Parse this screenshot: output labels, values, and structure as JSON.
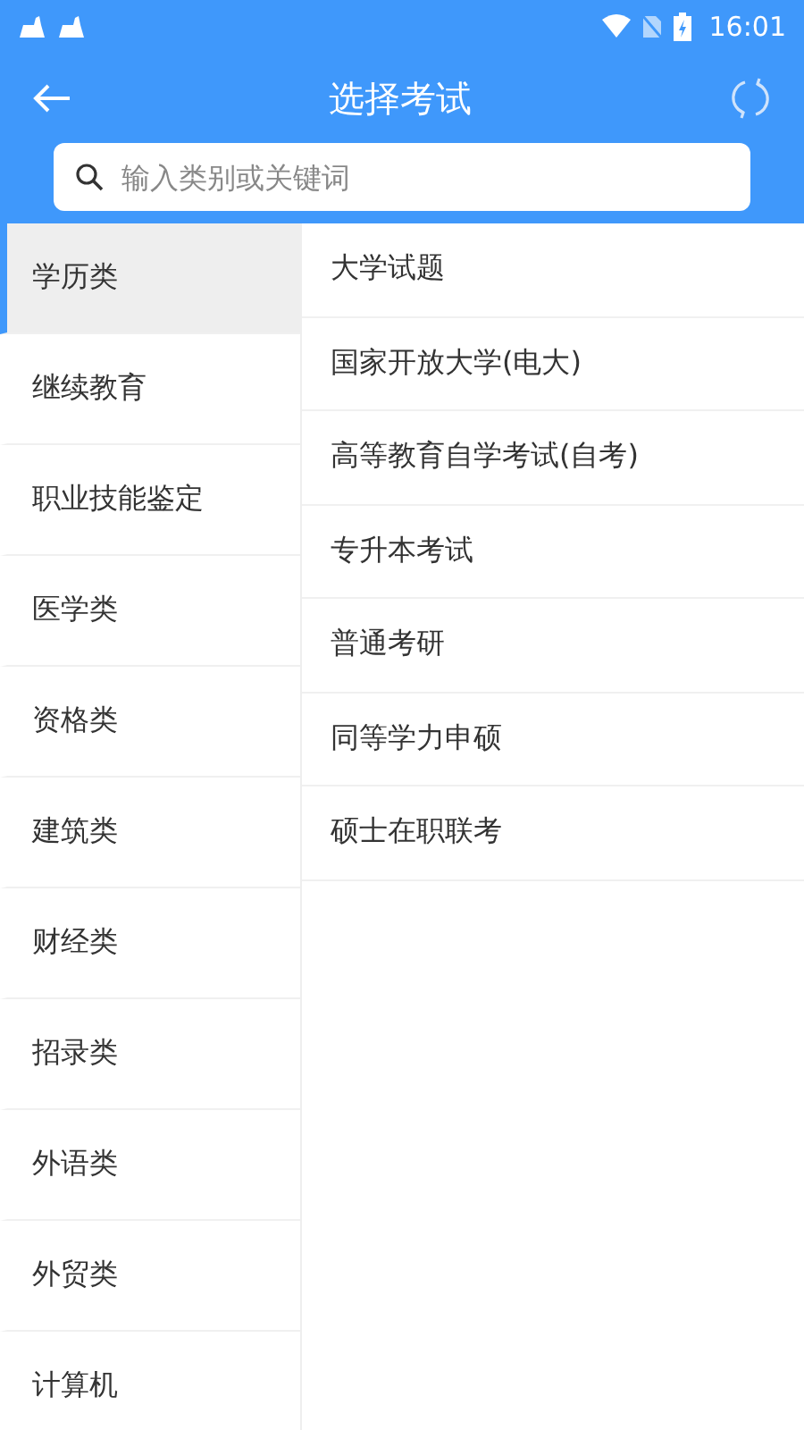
{
  "status_bar": {
    "time": "16:01"
  },
  "header": {
    "title": "选择考试"
  },
  "search": {
    "placeholder": "输入类别或关键词"
  },
  "categories": [
    {
      "label": "学历类",
      "selected": true
    },
    {
      "label": "继续教育",
      "selected": false
    },
    {
      "label": "职业技能鉴定",
      "selected": false
    },
    {
      "label": "医学类",
      "selected": false
    },
    {
      "label": "资格类",
      "selected": false
    },
    {
      "label": "建筑类",
      "selected": false
    },
    {
      "label": "财经类",
      "selected": false
    },
    {
      "label": "招录类",
      "selected": false
    },
    {
      "label": "外语类",
      "selected": false
    },
    {
      "label": "外贸类",
      "selected": false
    },
    {
      "label": "计算机",
      "selected": false
    }
  ],
  "exams": [
    {
      "label": "大学试题"
    },
    {
      "label": "国家开放大学(电大)"
    },
    {
      "label": "高等教育自学考试(自考)"
    },
    {
      "label": "专升本考试"
    },
    {
      "label": "普通考研"
    },
    {
      "label": "同等学力申硕"
    },
    {
      "label": "硕士在职联考"
    }
  ]
}
